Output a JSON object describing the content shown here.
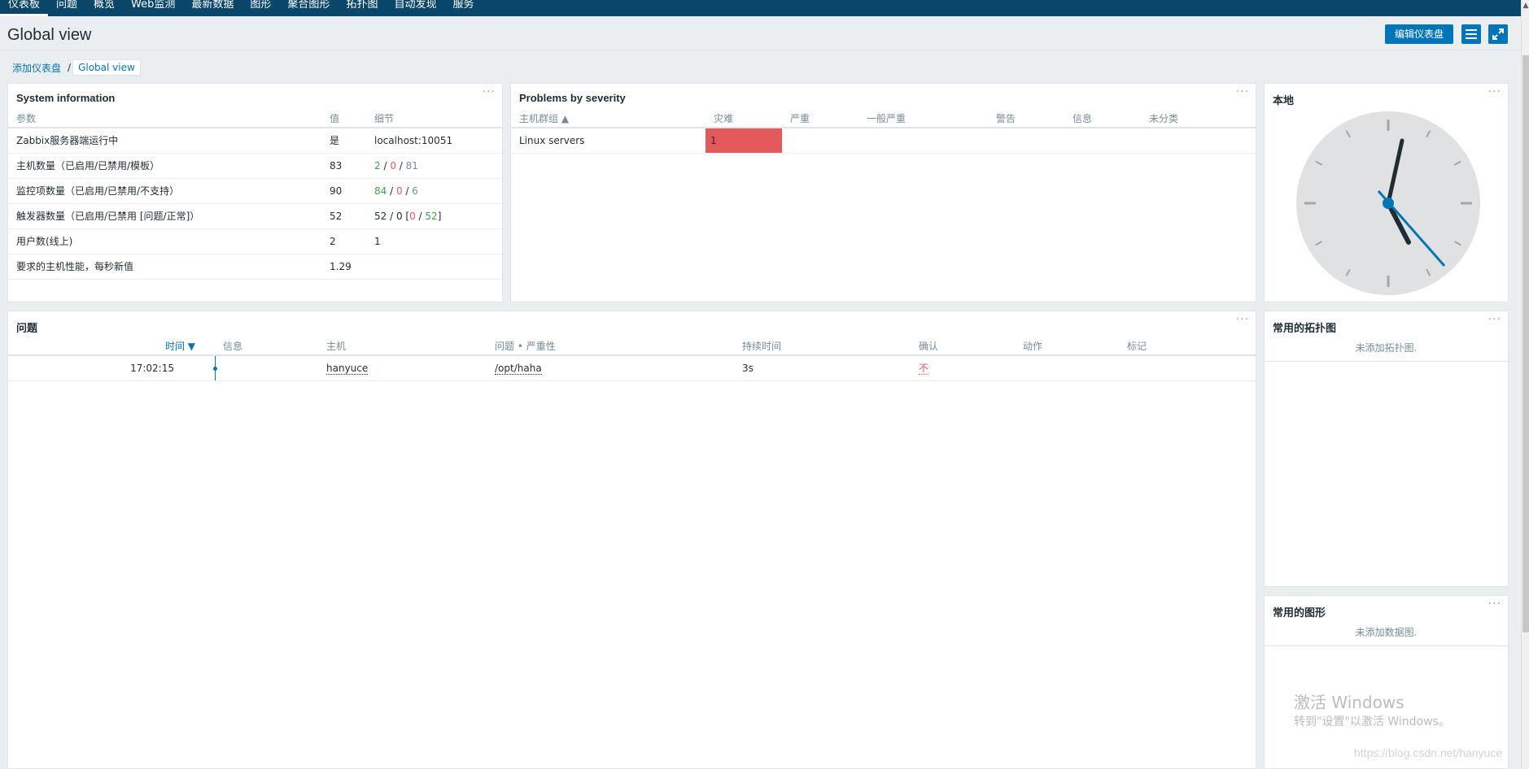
{
  "topnav": {
    "items": [
      "仪表板",
      "问题",
      "概览",
      "Web监测",
      "最新数据",
      "图形",
      "聚合图形",
      "拓扑图",
      "自动发现",
      "服务"
    ]
  },
  "header": {
    "title": "Global view",
    "edit_button": "编辑仪表盘",
    "menu_icon": "hamburger-menu-icon",
    "fullscreen_icon": "fullscreen-icon"
  },
  "breadcrumb": {
    "parent": "添加仪表盘",
    "separator": "/",
    "current": "Global view"
  },
  "system_info": {
    "title": "System information",
    "menu": "···",
    "columns": [
      "参数",
      "值",
      "细节"
    ],
    "rows": [
      {
        "param": "Zabbix服务器端运行中",
        "value": "是",
        "detail": "localhost:10051"
      },
      {
        "param": "主机数量（已启用/已禁用/模板）",
        "value": "83",
        "d1": "2",
        "d2": "0",
        "d3": "81"
      },
      {
        "param": "监控项数量（已启用/已禁用/不支持）",
        "value": "90",
        "d1": "84",
        "d2": "0",
        "d3": "6"
      },
      {
        "param": "触发器数量（已启用/已禁用 [问题/正常]）",
        "value": "52",
        "d1": "52",
        "d2": "0",
        "d3": "0",
        "d4": "52"
      },
      {
        "param": "用户数(线上)",
        "value": "2",
        "detail": "1"
      },
      {
        "param": "要求的主机性能，每秒新值",
        "value": "1.29",
        "detail": ""
      }
    ]
  },
  "problems_by_severity": {
    "title": "Problems by severity",
    "menu": "···",
    "columns": [
      "主机群组 ▲",
      "灾难",
      "严重",
      "一般严重",
      "警告",
      "信息",
      "未分类"
    ],
    "rows": [
      {
        "group": "Linux servers",
        "disaster": "1",
        "high": "",
        "average": "",
        "warning": "",
        "information": "",
        "not_classified": ""
      }
    ]
  },
  "clock": {
    "title": "本地",
    "menu": "···"
  },
  "problems": {
    "title": "问题",
    "menu": "···",
    "columns": [
      "时间 ▼",
      "信息",
      "主机",
      "问题 • 严重性",
      "持续时间",
      "确认",
      "动作",
      "标记"
    ],
    "rows": [
      {
        "time": "17:02:15",
        "info": "",
        "host": "hanyuce",
        "problem": "/opt/haha",
        "duration": "3s",
        "ack": "不",
        "actions": "",
        "tags": ""
      }
    ]
  },
  "fav_maps": {
    "title": "常用的拓扑图",
    "menu": "···",
    "empty": "未添加拓扑图."
  },
  "fav_graphs": {
    "title": "常用的图形",
    "menu": "···",
    "empty": "未添加数据图."
  },
  "watermark": {
    "activate": "激活 Windows",
    "hint": "转到\"设置\"以激活 Windows。",
    "url": "https://blog.csdn.net/hanyuce"
  },
  "colors": {
    "nav": "#0a466a",
    "primary": "#0275b8",
    "disaster": "#e45959",
    "ok": "#429e47"
  }
}
